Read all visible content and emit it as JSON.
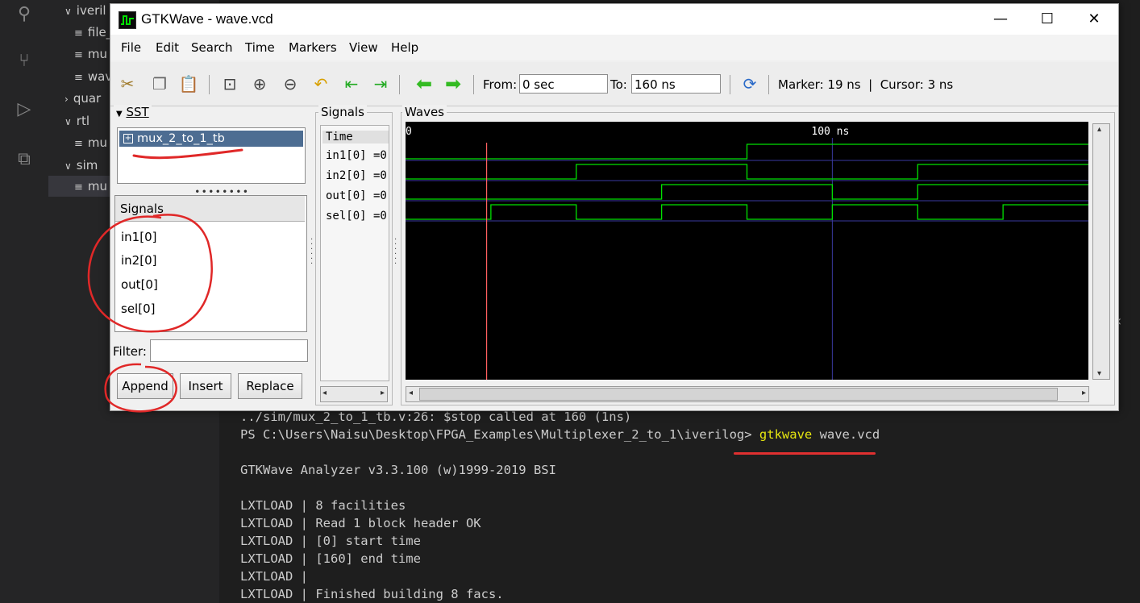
{
  "explorer": {
    "items": [
      {
        "label": "iveril",
        "type": "folder-open"
      },
      {
        "label": "file_",
        "type": "file"
      },
      {
        "label": "mu",
        "type": "file"
      },
      {
        "label": "wav",
        "type": "file"
      },
      {
        "label": "quar",
        "type": "folder-closed"
      },
      {
        "label": "rtl",
        "type": "folder-open"
      },
      {
        "label": "mu",
        "type": "file"
      },
      {
        "label": "sim",
        "type": "folder-open"
      },
      {
        "label": "mu",
        "type": "file"
      }
    ]
  },
  "terminal": {
    "lines": [
      "../sim/mux_2_to_1_tb.v:26: $stop called at 160 (1ns)",
      "PS C:\\Users\\Naisu\\Desktop\\FPGA_Examples\\Multiplexer_2_to_1\\iverilog> ",
      "",
      "GTKWave Analyzer v3.3.100 (w)1999-2019 BSI",
      "",
      "LXTLOAD | 8 facilities",
      "LXTLOAD | Read 1 block header OK",
      "LXTLOAD | [0] start time",
      "LXTLOAD | [160] end time",
      "LXTLOAD |",
      "LXTLOAD | Finished building 8 facs."
    ],
    "command": "gtkwave",
    "command_arg": " wave.vcd"
  },
  "window": {
    "title": "GTKWave - wave.vcd",
    "minimize": "—",
    "maximize": "☐",
    "close": "✕"
  },
  "menu": [
    "File",
    "Edit",
    "Search",
    "Time",
    "Markers",
    "View",
    "Help"
  ],
  "toolbar": {
    "from_label": "From:",
    "from_value": "0 sec",
    "to_label": "To:",
    "to_value": "160 ns",
    "marker_text": "Marker: 19 ns  |  Cursor: 3 ns",
    "icons": [
      "cut-icon",
      "copy-icon",
      "paste-icon",
      "zoom-fit-icon",
      "zoom-in-icon",
      "zoom-out-icon",
      "undo-zoom-icon",
      "zoom-begin-icon",
      "zoom-end-icon",
      "prev-edge-icon",
      "next-edge-icon",
      "reload-icon"
    ]
  },
  "sst": {
    "label": "SST",
    "tree_item": "mux_2_to_1_tb"
  },
  "signals_panel": {
    "header": "Signals",
    "items": [
      "in1[0]",
      "in2[0]",
      "out[0]",
      "sel[0]"
    ],
    "filter_label": "Filter:",
    "filter_value": "",
    "buttons": [
      "Append",
      "Insert",
      "Replace"
    ]
  },
  "signal_column": {
    "label": "Signals",
    "rows": [
      "Time",
      "in1[0] =0",
      "in2[0] =0",
      "out[0] =0",
      "sel[0] =0"
    ]
  },
  "waves": {
    "label": "Waves",
    "time_start": "0",
    "time_mid_label": "100 ns",
    "time_range_ns": [
      0,
      160
    ],
    "marker_ns": 19,
    "signals": [
      {
        "name": "in1[0]",
        "transitions_ns": [
          0,
          80
        ],
        "levels": [
          0,
          1
        ]
      },
      {
        "name": "in2[0]",
        "transitions_ns": [
          0,
          40,
          80,
          120
        ],
        "levels": [
          0,
          1,
          0,
          1
        ]
      },
      {
        "name": "out[0]",
        "transitions_ns": [
          0,
          60,
          100,
          120
        ],
        "levels": [
          0,
          1,
          0,
          1
        ]
      },
      {
        "name": "sel[0]",
        "transitions_ns": [
          0,
          20,
          40,
          60,
          80,
          100,
          120,
          140
        ],
        "levels": [
          0,
          1,
          0,
          1,
          0,
          1,
          0,
          1
        ]
      }
    ],
    "colors": {
      "wave": "#00e000",
      "marker": "#ff6060",
      "grid": "#3a3aa0",
      "background": "#000000"
    }
  }
}
